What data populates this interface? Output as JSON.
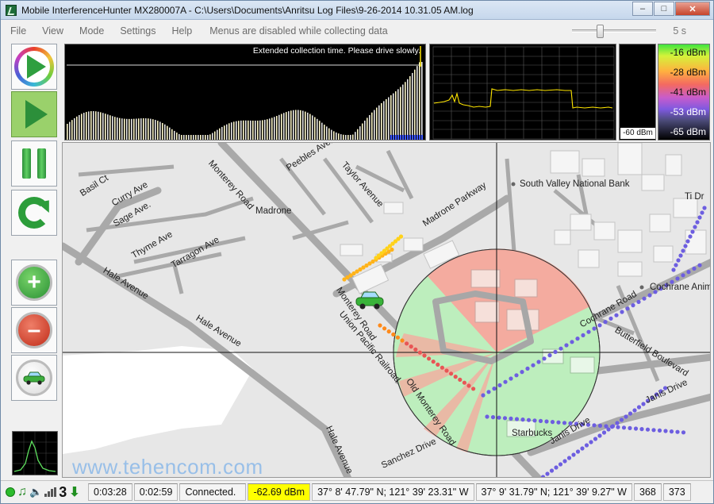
{
  "window": {
    "title": "Mobile InterferenceHunter MX280007A - C:\\Users\\Documents\\Anritsu Log Files\\9-26-2014 10.31.05 AM.log",
    "controls": [
      "minimize",
      "maximize",
      "close"
    ]
  },
  "menu": {
    "items": [
      "File",
      "View",
      "Mode",
      "Settings",
      "Help"
    ],
    "note": "Menus are disabled while collecting data",
    "slider_value": "5 s"
  },
  "toolbar": {
    "buttons": [
      "play-color-icon",
      "play-icon",
      "pause-icon",
      "refresh-icon",
      "zoom-in-icon",
      "zoom-out-icon",
      "car-icon",
      "spectrum-icon"
    ]
  },
  "graphs": {
    "message": "Extended collection time.  Please drive slowly.",
    "level_label": "-60 dBm",
    "scale": [
      "-16 dBm",
      "-28 dBm",
      "-41 dBm",
      "-53 dBm",
      "-65 dBm"
    ]
  },
  "map": {
    "labels": [
      "Basil Ct",
      "Curry Ave",
      "Sage Ave.",
      "Thyme Ave",
      "Tarragon Ave",
      "Hale Avenue",
      "Hale Avenue",
      "Monterey Road",
      "Madrone",
      "Peebles Avenue",
      "Taylor Avenue",
      "Madrone Parkway",
      "Monterey Road",
      "Union Pacific Railroad",
      "Old Monterey Road",
      "Sanchez Drive",
      "Hale Avenue",
      "South Valley National Bank",
      "Cochrane Road",
      "Butterfield Boulevard",
      "Janis Drive",
      "Janis Drive",
      "Starbucks",
      "Cochrane Animal",
      "Ti Dr"
    ],
    "colors": {
      "bearing_red": "#f2a59b",
      "bearing_green": "#b6eab7",
      "track_purple": "#6f5fe0",
      "track_orange": "#ff8a1a"
    }
  },
  "watermark": "www.tehencom.com",
  "status": {
    "elapsed": "0:03:28",
    "remaining": "0:02:59",
    "connection": "Connected.",
    "power": "-62.69 dBm",
    "position1": "37° 8' 47.79\" N; 121° 39' 23.31\" W",
    "position2": "37° 9' 31.79\" N; 121° 39' 9.27\" W",
    "count1": "368",
    "count2": "373",
    "indicator_three": "3"
  }
}
